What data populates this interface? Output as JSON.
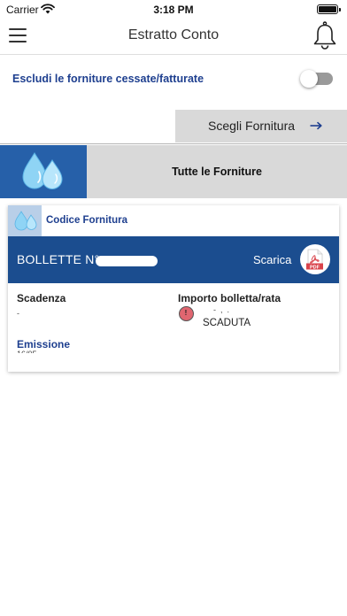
{
  "status_bar": {
    "carrier": "Carrier",
    "time": "3:18 PM"
  },
  "nav": {
    "title": "Estratto Conto"
  },
  "filter": {
    "label": "Escludi le forniture cessate/fatturate",
    "toggle_on": false
  },
  "choose_supply": {
    "label": "Scegli Fornitura"
  },
  "supply": {
    "label": "Tutte le Forniture"
  },
  "card": {
    "header_label": "Codice Fornitura",
    "bill_label": "BOLLETTE N°",
    "download_label": "Scarica",
    "pdf_icon_label": "PDF",
    "due_label": "Scadenza",
    "amount_label": "Importo bolletta/rata",
    "alert_count": "!",
    "status": "SCADUTA",
    "emission_label": "Emissione"
  },
  "colors": {
    "brand_blue": "#1b4d8f",
    "link_blue": "#1e3f8f",
    "supply_icon_bg": "#2660a9",
    "grey_button": "#d9d9d9",
    "alert_red": "#e06670",
    "pdf_red": "#d9434b"
  },
  "icons": [
    "wifi-icon",
    "battery-icon",
    "menu-icon",
    "bell-icon",
    "arrow-right-icon",
    "water-drops-icon",
    "pdf-icon",
    "alert-icon"
  ]
}
